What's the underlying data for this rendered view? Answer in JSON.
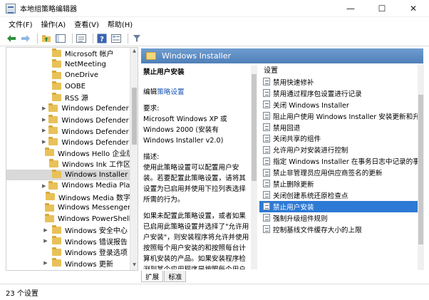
{
  "window": {
    "title": "本地组策略编辑器",
    "controls": {
      "minimize": "—",
      "maximize": "☐",
      "close": "✕"
    }
  },
  "menu": [
    {
      "label": "文件(F)"
    },
    {
      "label": "操作(A)"
    },
    {
      "label": "查看(V)"
    },
    {
      "label": "帮助(H)"
    }
  ],
  "toolbar": [
    {
      "name": "back-arrow-icon"
    },
    {
      "name": "forward-arrow-icon"
    },
    {
      "name": "up-folder-icon"
    },
    {
      "name": "show-hide-tree-icon"
    },
    {
      "name": "export-list-icon"
    },
    {
      "name": "help-icon"
    },
    {
      "name": "properties-icon"
    },
    {
      "name": "filter-icon"
    }
  ],
  "tree": {
    "items": [
      {
        "label": "Microsoft 帐户",
        "expandable": false,
        "selected": false
      },
      {
        "label": "NetMeeting",
        "expandable": false,
        "selected": false
      },
      {
        "label": "OneDrive",
        "expandable": false,
        "selected": false
      },
      {
        "label": "OOBE",
        "expandable": false,
        "selected": false
      },
      {
        "label": "RSS 源",
        "expandable": false,
        "selected": false
      },
      {
        "label": "Windows Defender S",
        "expandable": true,
        "selected": false
      },
      {
        "label": "Windows Defender 身",
        "expandable": true,
        "selected": false
      },
      {
        "label": "Windows Defender 防",
        "expandable": true,
        "selected": false
      },
      {
        "label": "Windows Defender 应",
        "expandable": true,
        "selected": false
      },
      {
        "label": "Windows Hello 企业版",
        "expandable": false,
        "selected": false
      },
      {
        "label": "Windows Ink 工作区",
        "expandable": false,
        "selected": false
      },
      {
        "label": "Windows Installer",
        "expandable": false,
        "selected": true
      },
      {
        "label": "Windows Media Play",
        "expandable": true,
        "selected": false
      },
      {
        "label": "Windows Media 数字",
        "expandable": false,
        "selected": false
      },
      {
        "label": "Windows Messenger",
        "expandable": false,
        "selected": false
      },
      {
        "label": "Windows PowerShell",
        "expandable": false,
        "selected": false
      },
      {
        "label": "Windows 安全中心",
        "expandable": true,
        "selected": false
      },
      {
        "label": "Windows 错误报告",
        "expandable": true,
        "selected": false
      },
      {
        "label": "Windows 登录选项",
        "expandable": false,
        "selected": false
      },
      {
        "label": "Windows 更新",
        "expandable": true,
        "selected": false
      }
    ]
  },
  "details": {
    "header_title": "Windows Installer",
    "policy_title": "禁止用户安装",
    "edit_prefix": "编辑",
    "edit_link": "策略设置",
    "requirements": "要求:\nMicrosoft Windows XP 或 Windows 2000 (安装有 Windows Installer v2.0)",
    "description": "描述:\n使用此策略设置可以配置用户安装。若要配置此策略设置，请将其设置为已启用并使用下拉列表选择所需的行为。",
    "description2": "如果未配置此策略设置，或者如果已启用此策略设置并选择了\"允许用户安装\"，则安装程序将允许并使用按照每个用户安装的和按照每台计算机安装的产品。如果安装程序检测到某个应用程序是按照每个用户安装的"
  },
  "settings": {
    "column_header": "设置",
    "items": [
      {
        "label": "禁用快速修补",
        "selected": false
      },
      {
        "label": "禁用通过程序包设置进行记录",
        "selected": false
      },
      {
        "label": "关闭 Windows Installer",
        "selected": false
      },
      {
        "label": "阻止用户使用 Windows Installer 安装更新和升级",
        "selected": false
      },
      {
        "label": "禁用回退",
        "selected": false
      },
      {
        "label": "关闭共享的组件",
        "selected": false
      },
      {
        "label": "允许用户对安装进行控制",
        "selected": false
      },
      {
        "label": "指定 Windows Installer 在事务日志中记录的事务",
        "selected": false
      },
      {
        "label": "禁止非管理员应用供应商签名的更新",
        "selected": false
      },
      {
        "label": "禁止删除更新",
        "selected": false
      },
      {
        "label": "关闭创建系统还原检查点",
        "selected": false
      },
      {
        "label": "禁止用户安装",
        "selected": true
      },
      {
        "label": "强制升级组件规则",
        "selected": false
      },
      {
        "label": "控制基线文件缓存大小的上限",
        "selected": false
      }
    ]
  },
  "tabs": [
    {
      "label": "扩展",
      "active": true
    },
    {
      "label": "标准",
      "active": false
    }
  ],
  "status": {
    "text": "23 个设置"
  },
  "colors": {
    "header_gradient_top": "#6f9dd0",
    "header_gradient_bottom": "#4f7fb8",
    "selected_row": "#2d7ad6",
    "tree_selected": "#d9d9d9",
    "link": "#1c56b5"
  }
}
